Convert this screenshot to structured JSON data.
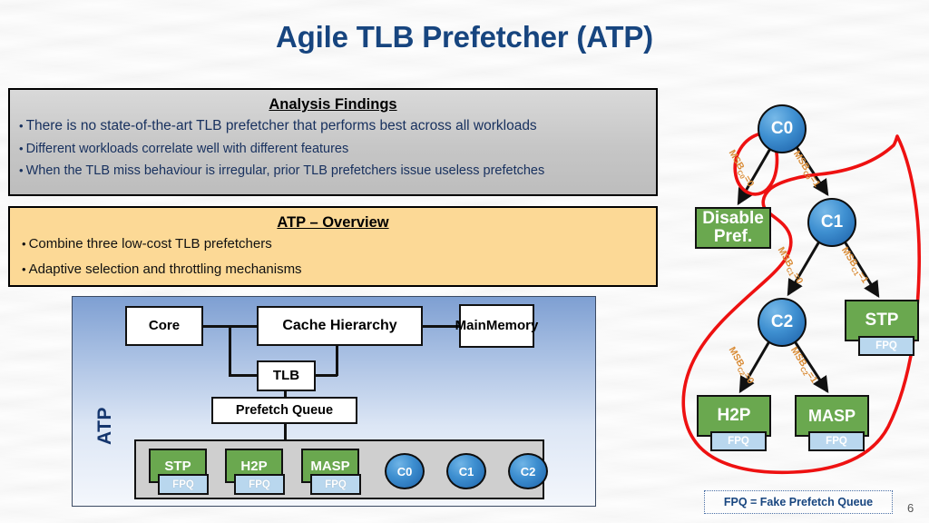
{
  "slide": {
    "title": "Agile TLB Prefetcher (ATP)",
    "page_number": "6",
    "title_color": "#17457f",
    "accent_green": "#6aa84f",
    "accent_blue": "#1b5ea6",
    "accent_orange": "#d98b35",
    "highlight_red": "#ee1111"
  },
  "findings": {
    "heading": "Analysis Findings",
    "bullets": [
      "There is no state-of-the-art TLB prefetcher that performs best across all workloads",
      "Different workloads correlate well with different features",
      "When the TLB miss behaviour is irregular, prior TLB prefetchers issue useless prefetches"
    ]
  },
  "overview": {
    "heading": "ATP – Overview",
    "bullets": [
      "Combine three low-cost TLB prefetchers",
      "Adaptive selection and throttling mechanisms"
    ]
  },
  "architecture": {
    "panel_label": "ATP",
    "boxes": {
      "core": "Core",
      "cache": "Cache Hierarchy",
      "main_memory": "Main\nMemory",
      "main_memory_line1": "Main",
      "main_memory_line2": "Memory",
      "tlb": "TLB",
      "prefetch_queue": "Prefetch Queue"
    },
    "prefetchers": [
      {
        "name": "STP",
        "fpq": "FPQ"
      },
      {
        "name": "H2P",
        "fpq": "FPQ"
      },
      {
        "name": "MASP",
        "fpq": "FPQ"
      }
    ],
    "counters": [
      "C0",
      "C1",
      "C2"
    ]
  },
  "tree": {
    "nodes": [
      {
        "id": "c0",
        "label": "C0"
      },
      {
        "id": "c1",
        "label": "C1"
      },
      {
        "id": "c2",
        "label": "C2"
      }
    ],
    "leaves": [
      {
        "id": "disable",
        "label": "Disable Pref.",
        "line1": "Disable",
        "line2": "Pref."
      },
      {
        "id": "stp",
        "label": "STP",
        "fpq": "FPQ"
      },
      {
        "id": "h2p",
        "label": "H2P",
        "fpq": "FPQ"
      },
      {
        "id": "masp",
        "label": "MASP",
        "fpq": "FPQ"
      }
    ],
    "edge_labels": [
      {
        "id": "c0-0",
        "prefix": "MSB",
        "sub": "C0",
        "suffix": "=0"
      },
      {
        "id": "c0-1",
        "prefix": "MSB",
        "sub": "C0",
        "suffix": "=1"
      },
      {
        "id": "c1-0",
        "prefix": "MSB",
        "sub": "C1",
        "suffix": "=0"
      },
      {
        "id": "c1-1",
        "prefix": "MSB",
        "sub": "C1",
        "suffix": "=1"
      },
      {
        "id": "c2-0",
        "prefix": "MSB",
        "sub": "C2",
        "suffix": "=0"
      },
      {
        "id": "c2-1",
        "prefix": "MSB",
        "sub": "C2",
        "suffix": "=1"
      }
    ]
  },
  "legend": {
    "text": "FPQ = Fake Prefetch Queue"
  }
}
